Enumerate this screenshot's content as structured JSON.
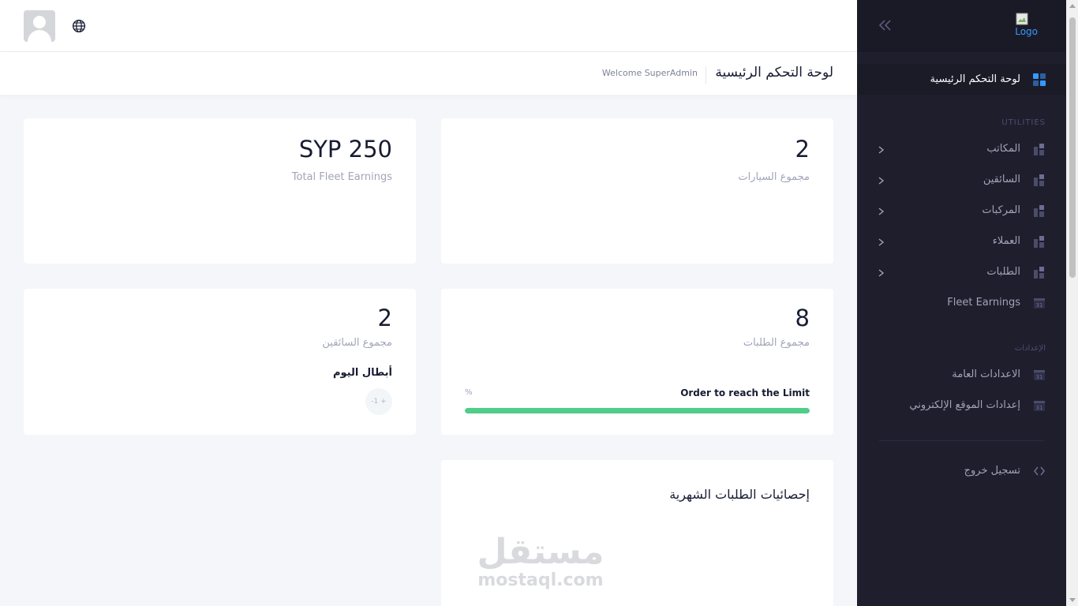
{
  "header": {
    "page_title": "لوحة التحكم الرئيسية",
    "welcome": "Welcome SuperAdmin"
  },
  "cards": {
    "cars": {
      "value": "2",
      "label": "مجموع السيارات"
    },
    "earnings": {
      "value": "SYP 250",
      "label": "Total Fleet Earnings"
    },
    "orders": {
      "value": "8",
      "label": "مجموع الطلبات",
      "progress_title": "Order to reach the Limit",
      "progress_unit": "%",
      "progress_value": 1.0
    },
    "drivers": {
      "value": "2",
      "label": "مجموع السائقين",
      "champions_label": "أبطال اليوم",
      "badge": "-1 +"
    },
    "monthly_stats": {
      "title": "إحصائيات الطلبات الشهرية"
    }
  },
  "watermark": {
    "arabic": "مستقل",
    "english": "mostaql.com"
  },
  "sidebar": {
    "logo_alt": "Logo",
    "active_item": "لوحة التحكم الرئيسية",
    "section_utilities": "UTILITIES",
    "utilities": [
      {
        "label": "المكاتب",
        "icon": "layers-icon",
        "has_submenu": true
      },
      {
        "label": "السائقين",
        "icon": "layers-icon",
        "has_submenu": true
      },
      {
        "label": "المركبات",
        "icon": "layers-icon",
        "has_submenu": true
      },
      {
        "label": "العملاء",
        "icon": "layers-icon",
        "has_submenu": true
      },
      {
        "label": "الطلبات",
        "icon": "layers-icon",
        "has_submenu": true
      },
      {
        "label": "Fleet Earnings",
        "icon": "calendar-icon",
        "has_submenu": false
      }
    ],
    "section_settings": "الإعدادات",
    "settings": [
      {
        "label": "الاعدادات العامة",
        "icon": "calendar-icon"
      },
      {
        "label": "إعدادات الموقع الإلكتروني",
        "icon": "calendar-icon"
      }
    ],
    "logout": "تسجيل خروج",
    "calendar_day": "31"
  },
  "colors": {
    "sidebar_bg": "#1e1e2d",
    "accent": "#3699ff",
    "success": "#50cd89",
    "page_bg": "#f4f6fa"
  }
}
